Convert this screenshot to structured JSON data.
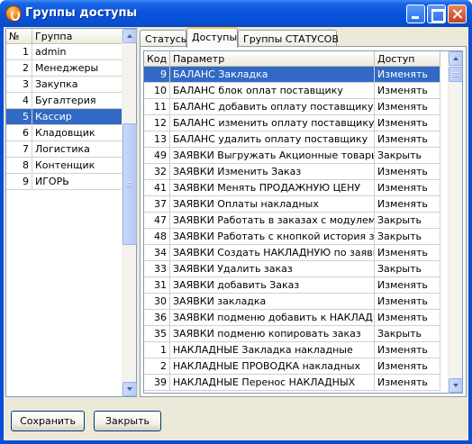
{
  "window": {
    "title": "Группы доступы"
  },
  "groups": {
    "columns": {
      "num": "№",
      "name": "Группа"
    },
    "rows": [
      {
        "num": "1",
        "name": "admin"
      },
      {
        "num": "2",
        "name": "Менеджеры"
      },
      {
        "num": "3",
        "name": "Закупка"
      },
      {
        "num": "4",
        "name": "Бугалтерия"
      },
      {
        "num": "5",
        "name": "Кассир"
      },
      {
        "num": "6",
        "name": "Кладовщик"
      },
      {
        "num": "7",
        "name": "Логистика"
      },
      {
        "num": "8",
        "name": "Контенщик"
      },
      {
        "num": "9",
        "name": "ИГОРЬ"
      }
    ],
    "selected_index": 4
  },
  "tabs": [
    {
      "label": "Статусы",
      "active": false
    },
    {
      "label": "Доступы",
      "active": true
    },
    {
      "label": "Группы СТАТУСОВ",
      "active": false
    }
  ],
  "params": {
    "columns": {
      "code": "Код",
      "param": "Параметр",
      "access": "Доступ"
    },
    "rows": [
      {
        "code": "9",
        "param": "БАЛАНС Закладка",
        "access": "Изменять"
      },
      {
        "code": "10",
        "param": "БАЛАНС блок оплат поставщику",
        "access": "Изменять"
      },
      {
        "code": "11",
        "param": "БАЛАНС добавить оплату поставщику",
        "access": "Изменять"
      },
      {
        "code": "12",
        "param": "БАЛАНС изменить оплату поставщику",
        "access": "Изменять"
      },
      {
        "code": "13",
        "param": "БАЛАНС удалить оплату поставщику",
        "access": "Изменять"
      },
      {
        "code": "49",
        "param": "ЗАЯВКИ Выгружать Акционные товары",
        "access": "Закрыть"
      },
      {
        "code": "32",
        "param": "ЗАЯВКИ Изменить Заказ",
        "access": "Изменять"
      },
      {
        "code": "41",
        "param": "ЗАЯВКИ Менять ПРОДАЖНУЮ ЦЕНУ",
        "access": "Изменять"
      },
      {
        "code": "37",
        "param": "ЗАЯВКИ Оплаты накладных",
        "access": "Изменять"
      },
      {
        "code": "47",
        "param": "ЗАЯВКИ Работать в заказах с модулем заказ",
        "access": "Закрыть"
      },
      {
        "code": "48",
        "param": "ЗАЯВКИ Работать с кнопкой история заказов",
        "access": "Закрыть"
      },
      {
        "code": "34",
        "param": "ЗАЯВКИ Создать НАКЛАДНУЮ по заявкам",
        "access": "Изменять"
      },
      {
        "code": "33",
        "param": "ЗАЯВКИ Удалить заказ",
        "access": "Закрыть"
      },
      {
        "code": "31",
        "param": "ЗАЯВКИ добавить Заказ",
        "access": "Изменять"
      },
      {
        "code": "30",
        "param": "ЗАЯВКИ закладка",
        "access": "Изменять"
      },
      {
        "code": "36",
        "param": "ЗАЯВКИ подменю добавить к НАКЛАДНОЙ",
        "access": "Изменять"
      },
      {
        "code": "35",
        "param": "ЗАЯВКИ подменю копировать заказ",
        "access": "Закрыть"
      },
      {
        "code": "1",
        "param": "НАКЛАДНЫЕ Закладка накладные",
        "access": "Изменять"
      },
      {
        "code": "2",
        "param": "НАКЛАДНЫЕ ПРОВОДКА накладных",
        "access": "Изменять"
      },
      {
        "code": "39",
        "param": "НАКЛАДНЫЕ Перенос НАКЛАДНЫХ",
        "access": "Изменять"
      }
    ],
    "selected_index": 0
  },
  "buttons": {
    "save": "Сохранить",
    "close": "Закрыть"
  },
  "colors": {
    "selection": "#316ac5",
    "titlebar": "#0a55de",
    "face": "#ece9d8"
  }
}
